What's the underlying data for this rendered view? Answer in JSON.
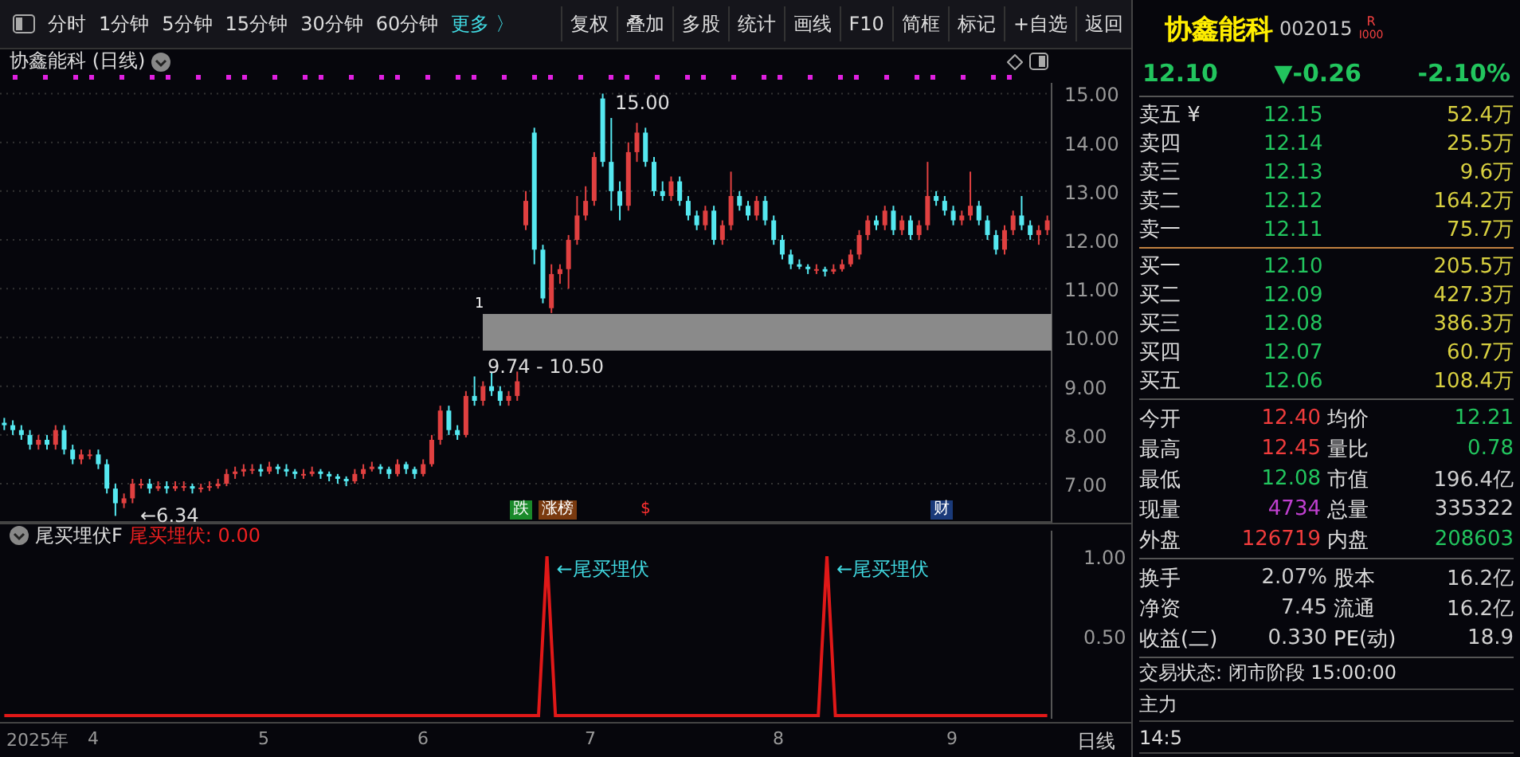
{
  "toolbar": {
    "periods": [
      "分时",
      "1分钟",
      "5分钟",
      "15分钟",
      "30分钟",
      "60分钟"
    ],
    "more": "更多 〉",
    "buttons": [
      "复权",
      "叠加",
      "多股",
      "统计",
      "画线",
      "F10",
      "简框",
      "标记",
      "+自选",
      "返回"
    ]
  },
  "main_chart": {
    "title": "协鑫能科 (日线)",
    "chart_data": {
      "type": "candlestick",
      "grid": true,
      "ylim": [
        6.2,
        15.22
      ],
      "yticks": [
        {
          "value": 15,
          "label": "15.00"
        },
        {
          "value": 14,
          "label": "14.00"
        },
        {
          "value": 13,
          "label": "13.00"
        },
        {
          "value": 12,
          "label": "12.00"
        },
        {
          "value": 11,
          "label": "11.00"
        },
        {
          "value": 10,
          "label": "10.00"
        },
        {
          "value": 9,
          "label": "9.00"
        },
        {
          "value": 8,
          "label": "8.00"
        },
        {
          "value": 7,
          "label": "7.00"
        }
      ],
      "ohlc": [
        [
          8.25,
          8.35,
          8.1,
          8.2
        ],
        [
          8.2,
          8.3,
          8.0,
          8.1
        ],
        [
          8.1,
          8.2,
          7.9,
          8.0
        ],
        [
          8.0,
          8.1,
          7.7,
          7.8
        ],
        [
          7.8,
          8.0,
          7.7,
          7.9
        ],
        [
          7.9,
          8.0,
          7.7,
          7.8
        ],
        [
          7.8,
          8.2,
          7.7,
          8.1
        ],
        [
          8.1,
          8.2,
          7.6,
          7.7
        ],
        [
          7.7,
          7.8,
          7.4,
          7.5
        ],
        [
          7.5,
          7.7,
          7.4,
          7.6
        ],
        [
          7.6,
          7.7,
          7.5,
          7.6
        ],
        [
          7.6,
          7.7,
          7.3,
          7.4
        ],
        [
          7.4,
          7.5,
          6.8,
          6.9
        ],
        [
          6.9,
          7.0,
          6.34,
          6.6
        ],
        [
          6.6,
          6.8,
          6.5,
          6.7
        ],
        [
          6.7,
          7.1,
          6.6,
          7.0
        ],
        [
          7.0,
          7.1,
          6.9,
          7.0
        ],
        [
          7.0,
          7.1,
          6.8,
          6.9
        ],
        [
          6.9,
          7.05,
          6.85,
          6.95
        ],
        [
          6.95,
          7.05,
          6.8,
          6.9
        ],
        [
          6.9,
          7.05,
          6.85,
          6.95
        ],
        [
          6.95,
          7.05,
          6.85,
          6.95
        ],
        [
          6.95,
          7.0,
          6.8,
          6.9
        ],
        [
          6.9,
          7.0,
          6.82,
          6.92
        ],
        [
          6.92,
          7.05,
          6.85,
          6.95
        ],
        [
          6.95,
          7.1,
          6.9,
          7.0
        ],
        [
          7.0,
          7.3,
          6.95,
          7.2
        ],
        [
          7.2,
          7.35,
          7.1,
          7.25
        ],
        [
          7.25,
          7.4,
          7.15,
          7.3
        ],
        [
          7.3,
          7.4,
          7.2,
          7.3
        ],
        [
          7.3,
          7.4,
          7.15,
          7.25
        ],
        [
          7.25,
          7.45,
          7.2,
          7.35
        ],
        [
          7.35,
          7.4,
          7.2,
          7.3
        ],
        [
          7.3,
          7.4,
          7.15,
          7.25
        ],
        [
          7.25,
          7.3,
          7.1,
          7.2
        ],
        [
          7.2,
          7.3,
          7.1,
          7.2
        ],
        [
          7.2,
          7.35,
          7.15,
          7.25
        ],
        [
          7.25,
          7.3,
          7.1,
          7.2
        ],
        [
          7.2,
          7.25,
          7.05,
          7.15
        ],
        [
          7.15,
          7.2,
          7.0,
          7.1
        ],
        [
          7.1,
          7.15,
          6.95,
          7.05
        ],
        [
          7.05,
          7.3,
          7.0,
          7.2
        ],
        [
          7.2,
          7.4,
          7.1,
          7.3
        ],
        [
          7.3,
          7.45,
          7.25,
          7.35
        ],
        [
          7.35,
          7.4,
          7.2,
          7.3
        ],
        [
          7.3,
          7.35,
          7.1,
          7.2
        ],
        [
          7.2,
          7.5,
          7.15,
          7.4
        ],
        [
          7.4,
          7.45,
          7.2,
          7.3
        ],
        [
          7.3,
          7.35,
          7.1,
          7.2
        ],
        [
          7.2,
          7.5,
          7.15,
          7.4
        ],
        [
          7.4,
          8.0,
          7.35,
          7.9
        ],
        [
          7.9,
          8.6,
          7.8,
          8.5
        ],
        [
          8.5,
          8.6,
          8.0,
          8.1
        ],
        [
          8.1,
          8.2,
          7.9,
          8.0
        ],
        [
          8.0,
          8.9,
          7.95,
          8.8
        ],
        [
          8.8,
          9.2,
          8.6,
          8.7
        ],
        [
          8.7,
          9.1,
          8.6,
          9.0
        ],
        [
          9.0,
          9.3,
          8.8,
          8.9
        ],
        [
          8.9,
          9.0,
          8.6,
          8.7
        ],
        [
          8.7,
          8.9,
          8.6,
          8.8
        ],
        [
          8.8,
          9.3,
          8.7,
          9.1
        ],
        [
          12.3,
          13.0,
          12.2,
          12.8
        ],
        [
          14.2,
          14.3,
          11.5,
          11.8
        ],
        [
          11.8,
          11.9,
          10.7,
          10.8
        ],
        [
          10.6,
          11.5,
          10.5,
          11.3
        ],
        [
          11.3,
          11.5,
          11.1,
          11.4
        ],
        [
          11.4,
          12.1,
          11.0,
          12.0
        ],
        [
          12.0,
          12.9,
          11.9,
          12.5
        ],
        [
          12.5,
          13.1,
          12.4,
          12.8
        ],
        [
          12.8,
          13.8,
          12.7,
          13.7
        ],
        [
          14.9,
          15.0,
          13.5,
          13.6
        ],
        [
          13.6,
          14.5,
          12.6,
          13.0
        ],
        [
          13.0,
          13.2,
          12.4,
          12.7
        ],
        [
          12.7,
          14.0,
          12.6,
          13.8
        ],
        [
          13.8,
          14.4,
          13.6,
          14.2
        ],
        [
          14.2,
          14.3,
          13.5,
          13.6
        ],
        [
          13.6,
          13.7,
          12.9,
          13.0
        ],
        [
          13.0,
          13.2,
          12.8,
          12.9
        ],
        [
          12.9,
          13.3,
          12.8,
          13.2
        ],
        [
          13.2,
          13.3,
          12.7,
          12.8
        ],
        [
          12.8,
          12.9,
          12.4,
          12.5
        ],
        [
          12.5,
          12.6,
          12.2,
          12.3
        ],
        [
          12.3,
          12.7,
          12.2,
          12.6
        ],
        [
          12.6,
          12.7,
          11.9,
          12.0
        ],
        [
          12.0,
          12.4,
          11.9,
          12.3
        ],
        [
          12.3,
          13.4,
          12.2,
          12.9
        ],
        [
          12.9,
          13.0,
          12.6,
          12.7
        ],
        [
          12.7,
          12.8,
          12.4,
          12.5
        ],
        [
          12.5,
          12.9,
          12.4,
          12.8
        ],
        [
          12.8,
          12.9,
          12.3,
          12.4
        ],
        [
          12.4,
          12.5,
          11.9,
          12.0
        ],
        [
          12.0,
          12.1,
          11.6,
          11.7
        ],
        [
          11.7,
          11.8,
          11.4,
          11.5
        ],
        [
          11.5,
          11.6,
          11.4,
          11.45
        ],
        [
          11.45,
          11.5,
          11.3,
          11.4
        ],
        [
          11.4,
          11.5,
          11.3,
          11.4
        ],
        [
          11.4,
          11.45,
          11.25,
          11.35
        ],
        [
          11.35,
          11.5,
          11.3,
          11.4
        ],
        [
          11.4,
          11.6,
          11.35,
          11.5
        ],
        [
          11.5,
          11.8,
          11.45,
          11.7
        ],
        [
          11.7,
          12.2,
          11.6,
          12.1
        ],
        [
          12.1,
          12.5,
          12.0,
          12.4
        ],
        [
          12.4,
          12.5,
          12.2,
          12.3
        ],
        [
          12.3,
          12.7,
          12.2,
          12.6
        ],
        [
          12.6,
          12.7,
          12.1,
          12.2
        ],
        [
          12.2,
          12.5,
          12.1,
          12.4
        ],
        [
          12.4,
          12.5,
          12.0,
          12.1
        ],
        [
          12.1,
          12.4,
          12.0,
          12.3
        ],
        [
          12.3,
          13.6,
          12.2,
          12.9
        ],
        [
          12.9,
          13.0,
          12.7,
          12.8
        ],
        [
          12.8,
          12.9,
          12.5,
          12.6
        ],
        [
          12.6,
          12.7,
          12.3,
          12.4
        ],
        [
          12.4,
          12.6,
          12.3,
          12.5
        ],
        [
          12.5,
          13.4,
          12.4,
          12.7
        ],
        [
          12.7,
          12.8,
          12.3,
          12.4
        ],
        [
          12.4,
          12.5,
          12.0,
          12.1
        ],
        [
          12.1,
          12.2,
          11.7,
          11.8
        ],
        [
          11.8,
          12.3,
          11.7,
          12.2
        ],
        [
          12.2,
          12.6,
          12.1,
          12.5
        ],
        [
          12.5,
          12.9,
          12.2,
          12.3
        ],
        [
          12.3,
          12.4,
          12.0,
          12.1
        ],
        [
          12.1,
          12.3,
          11.9,
          12.2
        ],
        [
          12.2,
          12.5,
          12.1,
          12.4
        ]
      ]
    },
    "high_label": "15.00",
    "low_label": "←6.34",
    "band_label": "9.74 - 10.50",
    "band_top_mark": "1",
    "events": [
      {
        "text": "跌",
        "kind": "down"
      },
      {
        "text": "涨榜",
        "kind": "list"
      },
      {
        "text": "$",
        "kind": "money"
      },
      {
        "text": "财",
        "kind": "finance"
      }
    ]
  },
  "indicator": {
    "name": "尾买埋伏F",
    "reading": "尾买埋伏: 0.00",
    "signal_labels": [
      "←尾买埋伏",
      "←尾买埋伏"
    ],
    "chart_data": {
      "type": "line",
      "ylim": [
        -0.02,
        1.16
      ],
      "yticks": [
        {
          "value": 1,
          "label": "1.00"
        },
        {
          "value": 0.5,
          "label": "0.50"
        }
      ],
      "series": [
        {
          "color": "#e01818",
          "values": [
            0,
            0,
            0,
            0,
            0,
            0,
            0,
            0,
            0,
            0,
            0,
            0,
            0,
            0,
            0,
            0,
            0,
            0,
            0,
            0,
            0,
            0,
            0,
            0,
            0,
            0,
            0,
            0,
            0,
            0,
            0,
            0,
            0,
            0,
            0,
            0,
            0,
            0,
            0,
            0,
            0,
            0,
            0,
            0,
            0,
            0,
            0,
            0,
            0,
            0,
            0,
            0,
            0,
            0,
            0,
            0,
            0,
            0,
            0,
            0,
            0,
            0,
            0,
            0,
            1,
            0,
            0,
            0,
            0,
            0,
            0,
            0,
            0,
            0,
            0,
            0,
            0,
            0,
            0,
            0,
            0,
            0,
            0,
            0,
            0,
            0,
            0,
            0,
            0,
            0,
            0,
            0,
            0,
            0,
            0,
            0,
            0,
            1,
            0,
            0,
            0,
            0,
            0,
            0,
            0,
            0,
            0,
            0,
            0,
            0,
            0,
            0,
            0,
            0,
            0,
            0,
            0,
            0,
            0,
            0,
            0,
            0,
            0,
            0
          ]
        }
      ]
    }
  },
  "date_axis": {
    "labels": [
      "2025年",
      "4",
      "5",
      "6",
      "7",
      "8",
      "9"
    ],
    "period": "日线"
  },
  "quote": {
    "name": "协鑫能科",
    "code": "002015",
    "flag_top": "R",
    "flag_bottom": "I000",
    "price": "12.10",
    "change": "▼-0.26",
    "change_pct": "-2.10%"
  },
  "asks": [
    {
      "label": "卖五 ¥",
      "price": "12.15",
      "volume": "52.4万"
    },
    {
      "label": "卖四",
      "price": "12.14",
      "volume": "25.5万"
    },
    {
      "label": "卖三",
      "price": "12.13",
      "volume": "9.6万"
    },
    {
      "label": "卖二",
      "price": "12.12",
      "volume": "164.2万"
    },
    {
      "label": "卖一",
      "price": "12.11",
      "volume": "75.7万"
    }
  ],
  "bids": [
    {
      "label": "买一",
      "price": "12.10",
      "volume": "205.5万"
    },
    {
      "label": "买二",
      "price": "12.09",
      "volume": "427.3万"
    },
    {
      "label": "买三",
      "price": "12.08",
      "volume": "386.3万"
    },
    {
      "label": "买四",
      "price": "12.07",
      "volume": "60.7万"
    },
    {
      "label": "买五",
      "price": "12.06",
      "volume": "108.4万"
    }
  ],
  "stats": [
    {
      "label": "今开",
      "value": "12.40",
      "color": "#f03c3c"
    },
    {
      "label": "均价",
      "value": "12.21",
      "color": "#22c55e"
    },
    {
      "label": "最高",
      "value": "12.45",
      "color": "#f03c3c"
    },
    {
      "label": "量比",
      "value": "0.78",
      "color": "#22c55e"
    },
    {
      "label": "最低",
      "value": "12.08",
      "color": "#22c55e"
    },
    {
      "label": "市值",
      "value": "196.4亿",
      "color": "#d0d0d0"
    },
    {
      "label": "现量",
      "value": "4734",
      "color": "#c040d0"
    },
    {
      "label": "总量",
      "value": "335322",
      "color": "#d0d0d0"
    },
    {
      "label": "外盘",
      "value": "126719",
      "color": "#f03c3c"
    },
    {
      "label": "内盘",
      "value": "208603",
      "color": "#22c55e"
    }
  ],
  "finance": [
    {
      "label": "换手",
      "value": "2.07%",
      "label2": "股本",
      "value2": "16.2亿"
    },
    {
      "label": "净资",
      "value": "7.45",
      "label2": "流通",
      "value2": "16.2亿"
    },
    {
      "label": "收益(二)",
      "value": "0.330",
      "label2": "PE(动)",
      "value2": "18.9"
    }
  ],
  "status": "交易状态: 闭市阶段 15:00:00",
  "main_force": "主力",
  "tick_time": "14:5"
}
